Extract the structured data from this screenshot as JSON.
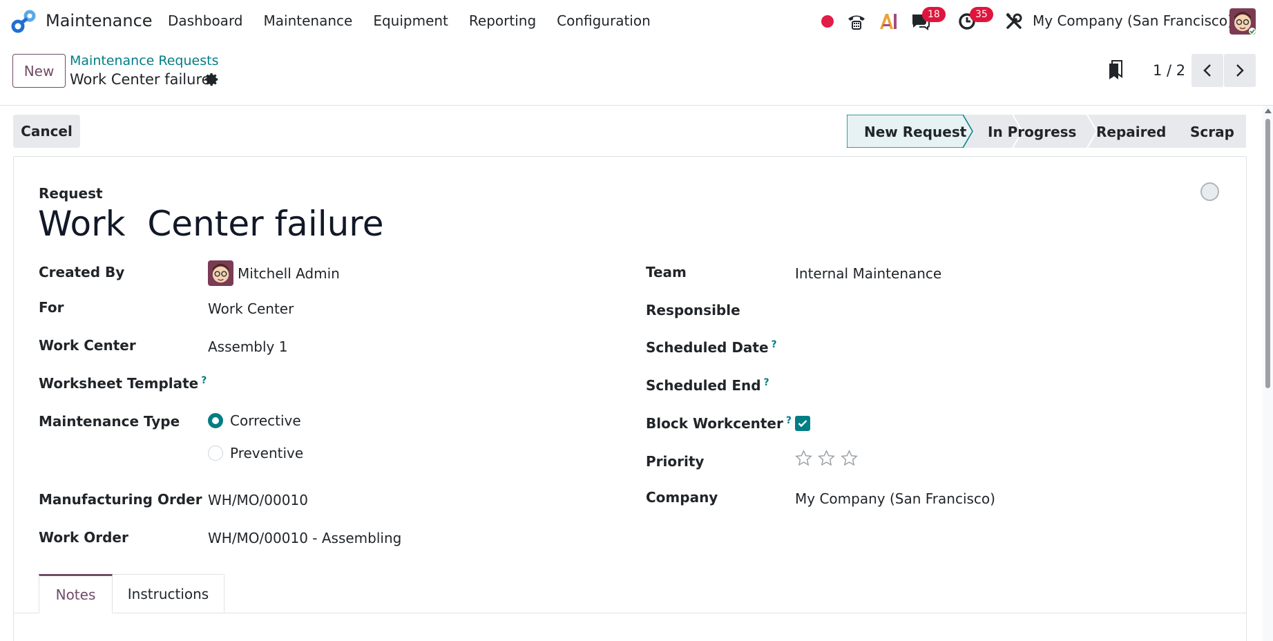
{
  "navbar": {
    "app_name": "Maintenance",
    "menu": [
      "Dashboard",
      "Maintenance",
      "Equipment",
      "Reporting",
      "Configuration"
    ],
    "chat_count": "18",
    "activity_count": "35",
    "company": "My Company (San Francisco)"
  },
  "control": {
    "new_label": "New",
    "breadcrumb": "Maintenance Requests",
    "record_title": "Work Center failure",
    "pager": "1 / 2"
  },
  "statusbar": {
    "cancel_label": "Cancel",
    "stages": [
      "New Request",
      "In Progress",
      "Repaired",
      "Scrap"
    ],
    "active_stage": "New Request"
  },
  "form": {
    "request_label": "Request",
    "title": "Work  Center failure",
    "left": {
      "created_by_label": "Created By",
      "created_by_value": "Mitchell Admin",
      "for_label": "For",
      "for_value": "Work Center",
      "work_center_label": "Work Center",
      "work_center_value": "Assembly 1",
      "worksheet_label": "Worksheet Template",
      "maintenance_type_label": "Maintenance Type",
      "type_options": [
        "Corrective",
        "Preventive"
      ],
      "selected_type": "Corrective",
      "mo_label": "Manufacturing Order",
      "mo_value": "WH/MO/00010",
      "work_order_label": "Work Order",
      "work_order_value": "WH/MO/00010 - Assembling"
    },
    "right": {
      "team_label": "Team",
      "team_value": "Internal Maintenance",
      "responsible_label": "Responsible",
      "scheduled_date_label": "Scheduled Date",
      "scheduled_end_label": "Scheduled End",
      "block_label": "Block Workcenter",
      "block_checked": true,
      "priority_label": "Priority",
      "priority_stars": 0,
      "priority_max": 3,
      "company_label": "Company",
      "company_value": "My Company (San Francisco)"
    },
    "help_mark": "?"
  },
  "tabs": [
    "Notes",
    "Instructions"
  ],
  "active_tab": "Notes",
  "colors": {
    "brand": "#714b67",
    "accent": "#017e84",
    "badge": "#e0153d",
    "record": "#e11d48"
  }
}
